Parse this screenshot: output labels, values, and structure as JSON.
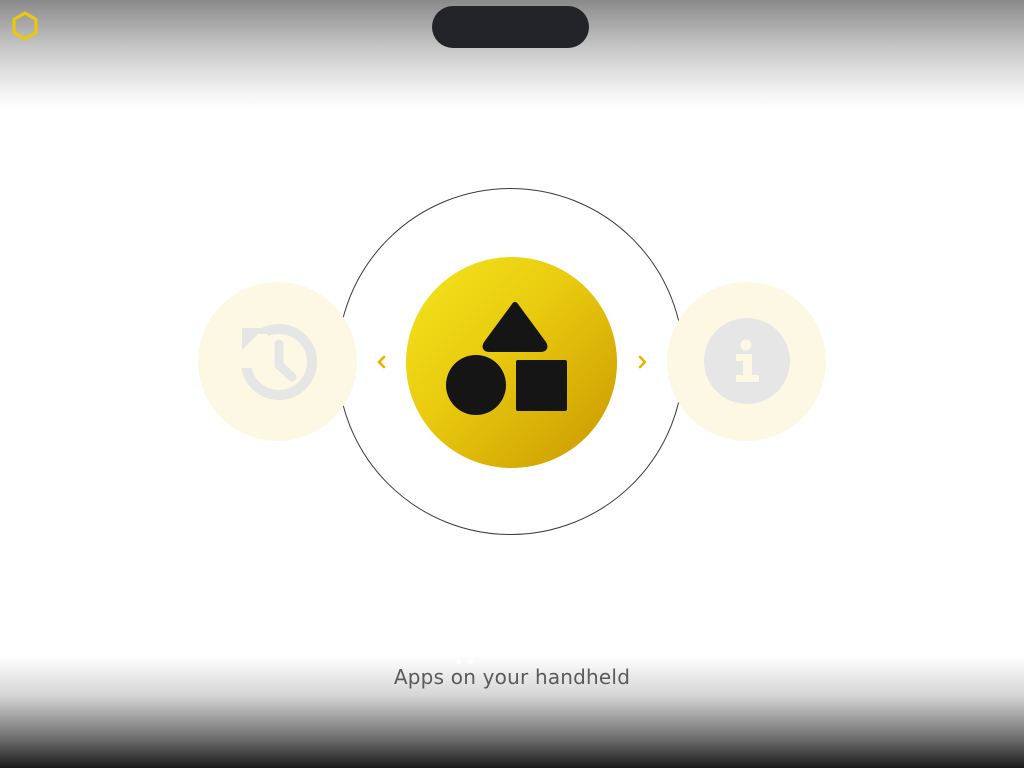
{
  "colors": {
    "accent": "#e8c90e",
    "accent_dark": "#c99600",
    "ring": "#3a3a3a",
    "pill": "#232427",
    "caption": "#5a5a5a",
    "side_app_bg": "#fdf8e4",
    "side_icon": "#e6e6e6",
    "main_icon": "#151515"
  },
  "header": {
    "home_icon": "hexagon-icon",
    "top_pill_text": ""
  },
  "carousel": {
    "selected_index": 1,
    "apps": [
      {
        "icon": "history-icon",
        "selected": false
      },
      {
        "icon": "shapes-icon",
        "selected": true
      },
      {
        "icon": "info-icon",
        "selected": false
      }
    ],
    "prev_icon": "chevron-left-icon",
    "next_icon": "chevron-right-icon"
  },
  "pager": {
    "count": 2,
    "current": 1
  },
  "caption": "Apps on your handheld"
}
